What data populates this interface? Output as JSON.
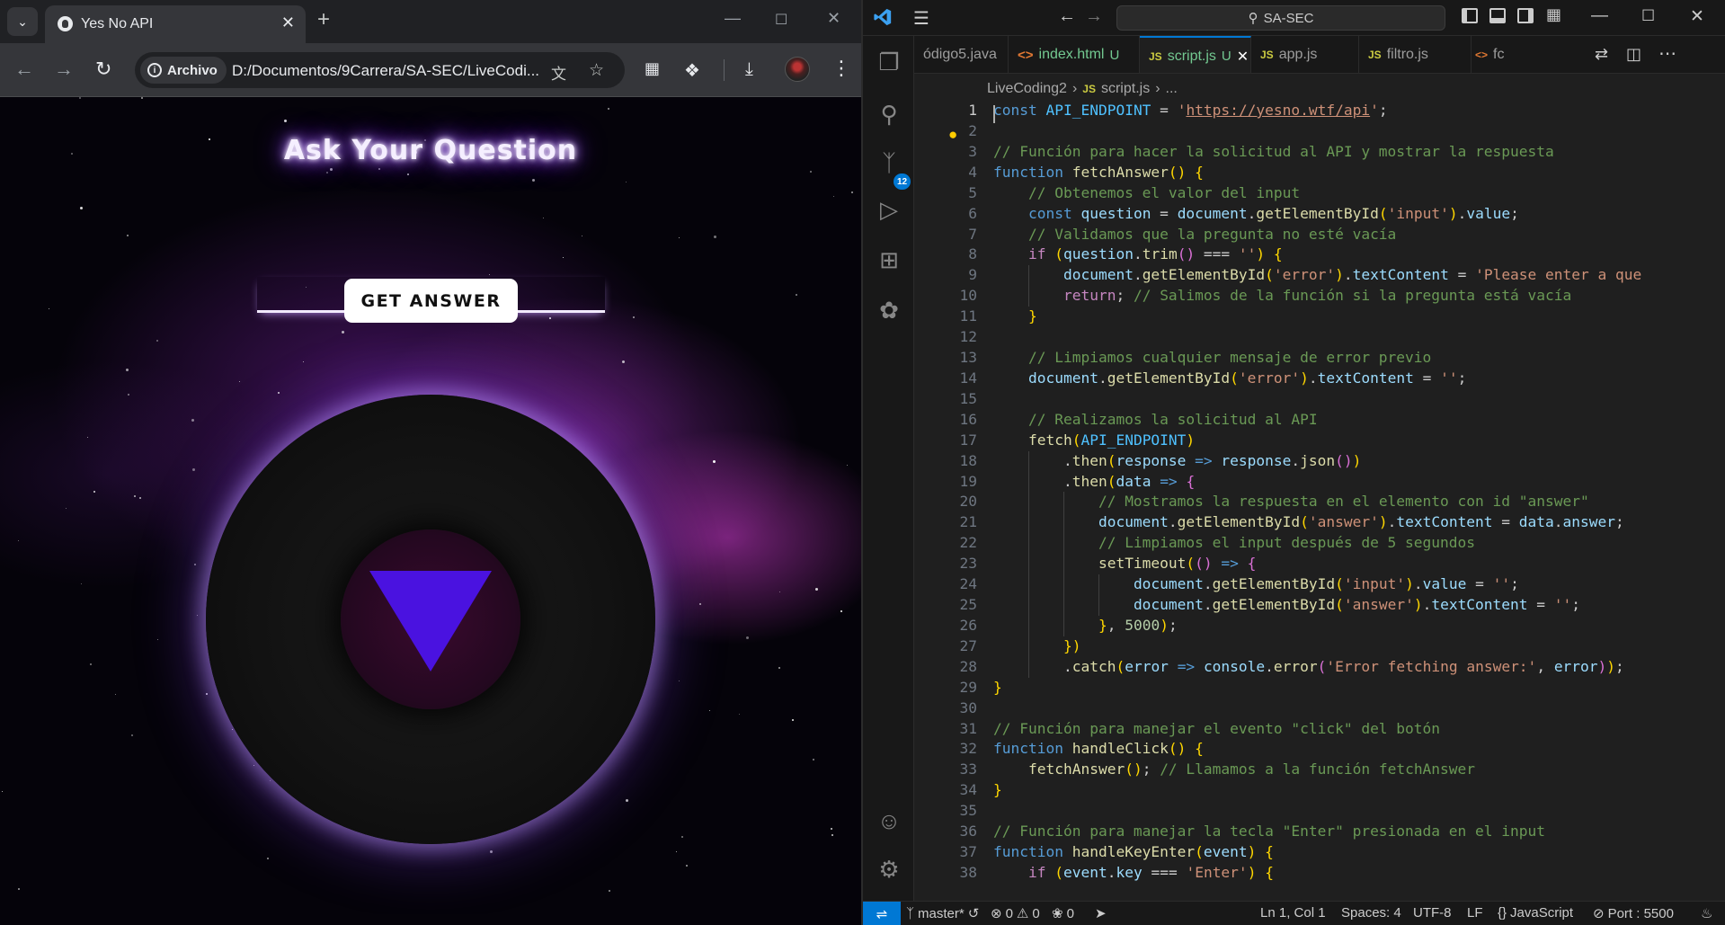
{
  "browser": {
    "tab_title": "Yes No API",
    "tab_close_icon": "close-icon",
    "new_tab_icon": "plus-icon",
    "site_info_label": "Archivo",
    "url": "D:/Documentos/9Carrera/SA-SEC/LiveCodi...",
    "page": {
      "heading": "Ask Your Question",
      "question_value": "",
      "button_label": "GET ANSWER",
      "answer_text": ""
    }
  },
  "vscode": {
    "command_center": "SA-SEC",
    "tabs": [
      {
        "label": "ódigo5.java",
        "status": ""
      },
      {
        "label": "index.html",
        "status": "U"
      },
      {
        "label": "script.js",
        "status": "U"
      },
      {
        "label": "app.js",
        "status": ""
      },
      {
        "label": "filtro.js",
        "status": ""
      },
      {
        "label": "fc",
        "status": ""
      }
    ],
    "breadcrumb": {
      "folder": "LiveCoding2",
      "file": "script.js",
      "more": "..."
    },
    "source_control_badge": "12",
    "status_bar": {
      "branch": "master*",
      "errors": "0",
      "warnings": "0",
      "ports_count": "0",
      "cursor_position": "Ln 1, Col 1",
      "indent": "Spaces: 4",
      "encoding": "UTF-8",
      "eol": "LF",
      "language": "JavaScript",
      "port": "Port : 5500"
    },
    "accent_color": "#0078d4",
    "code_lines": [
      "const API_ENDPOINT = 'https://yesno.wtf/api';",
      "",
      "// Función para hacer la solicitud al API y mostrar la respuesta",
      "function fetchAnswer() {",
      "    // Obtenemos el valor del input",
      "    const question = document.getElementById('input').value;",
      "    // Validamos que la pregunta no esté vacía",
      "    if (question.trim() === '') {",
      "        document.getElementById('error').textContent = 'Please enter a que",
      "        return; // Salimos de la función si la pregunta está vacía",
      "    }",
      "",
      "    // Limpiamos cualquier mensaje de error previo",
      "    document.getElementById('error').textContent = '';",
      "",
      "    // Realizamos la solicitud al API",
      "    fetch(API_ENDPOINT)",
      "        .then(response => response.json())",
      "        .then(data => {",
      "            // Mostramos la respuesta en el elemento con id \"answer\"",
      "            document.getElementById('answer').textContent = data.answer;",
      "            // Limpiamos el input después de 5 segundos",
      "            setTimeout(() => {",
      "                document.getElementById('input').value = '';",
      "                document.getElementById('answer').textContent = '';",
      "            }, 5000);",
      "        })",
      "        .catch(error => console.error('Error fetching answer:', error));",
      "}",
      "",
      "// Función para manejar el evento \"click\" del botón",
      "function handleClick() {",
      "    fetchAnswer(); // Llamamos a la función fetchAnswer",
      "}",
      "",
      "// Función para manejar la tecla \"Enter\" presionada en el input",
      "function handleKeyEnter(event) {",
      "    if (event.key === 'Enter') {"
    ]
  }
}
